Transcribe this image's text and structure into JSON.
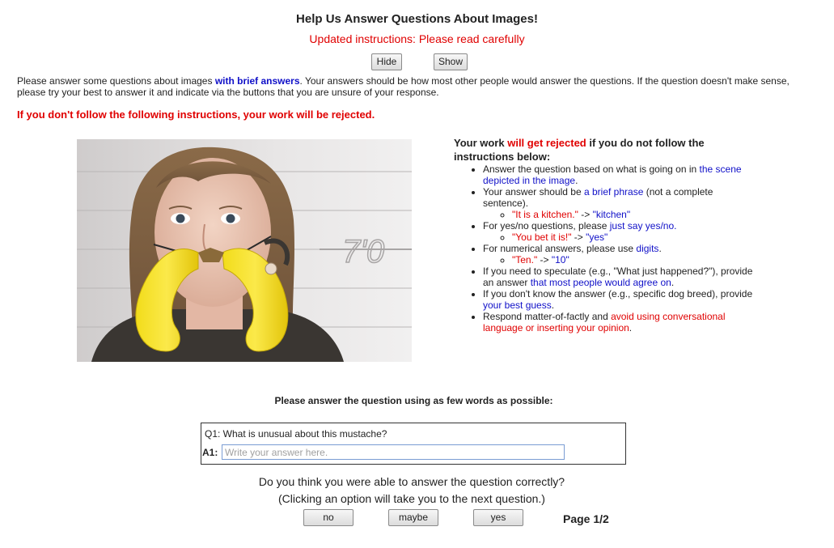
{
  "header": {
    "title": "Help Us Answer Questions About Images!",
    "subtitle": "Updated instructions: Please read carefully",
    "hide_label": "Hide",
    "show_label": "Show"
  },
  "intro": {
    "part1": "Please answer some questions about images ",
    "emph": "with brief answers",
    "part2": ". Your answers should be how most other people would answer the questions. If the question doesn't make sense, please try your best to answer it and indicate via the buttons that you are unsure of your response."
  },
  "warning": "If you don't follow the following instructions, your work will be rejected.",
  "rules": {
    "head1": "Your work ",
    "head_red": "will get rejected",
    "head2": " if you do not follow the instructions below:",
    "r1a": "Answer the question based on what is going on in ",
    "r1b": "the scene depicted in the image",
    "r1c": ".",
    "r2a": "Your answer should be ",
    "r2b": "a brief phrase",
    "r2c": " (not a complete sentence).",
    "r2ex_q": "\"It is a kitchen.\"",
    "r2ex_arrow": " -> ",
    "r2ex_a": "\"kitchen\"",
    "r3a": "For yes/no questions, please ",
    "r3b": "just say yes/no.",
    "r3ex_q": "\"You bet it is!\"",
    "r3ex_arrow": " -> ",
    "r3ex_a": "\"yes\"",
    "r4a": "For numerical answers, please use ",
    "r4b": "digits",
    "r4c": ".",
    "r4ex_q": "\"Ten.\"",
    "r4ex_arrow": " -> ",
    "r4ex_a": "\"10\"",
    "r5a": "If you need to speculate (e.g., \"What just happened?\"), provide an answer ",
    "r5b": "that most people would agree on",
    "r5c": ".",
    "r6a": "If you don't know the answer (e.g., specific dog breed), provide ",
    "r6b": "your best guess",
    "r6c": ".",
    "r7a": "Respond matter-of-factly and ",
    "r7b": "avoid using conversational language or inserting your opinion",
    "r7c": "."
  },
  "image": {
    "height_mark": "7'0"
  },
  "question": {
    "heading": "Please answer the question using as few words as possible:",
    "q_label": "Q1: What is unusual about this mustache?",
    "a_label": "A1:",
    "placeholder": "Write your answer here.",
    "value": ""
  },
  "confirm": {
    "line1": "Do you think you were able to answer the question correctly?",
    "line2": "(Clicking an option will take you to the next question.)",
    "no": "no",
    "maybe": "maybe",
    "yes": "yes"
  },
  "pagination": "Page 1/2"
}
